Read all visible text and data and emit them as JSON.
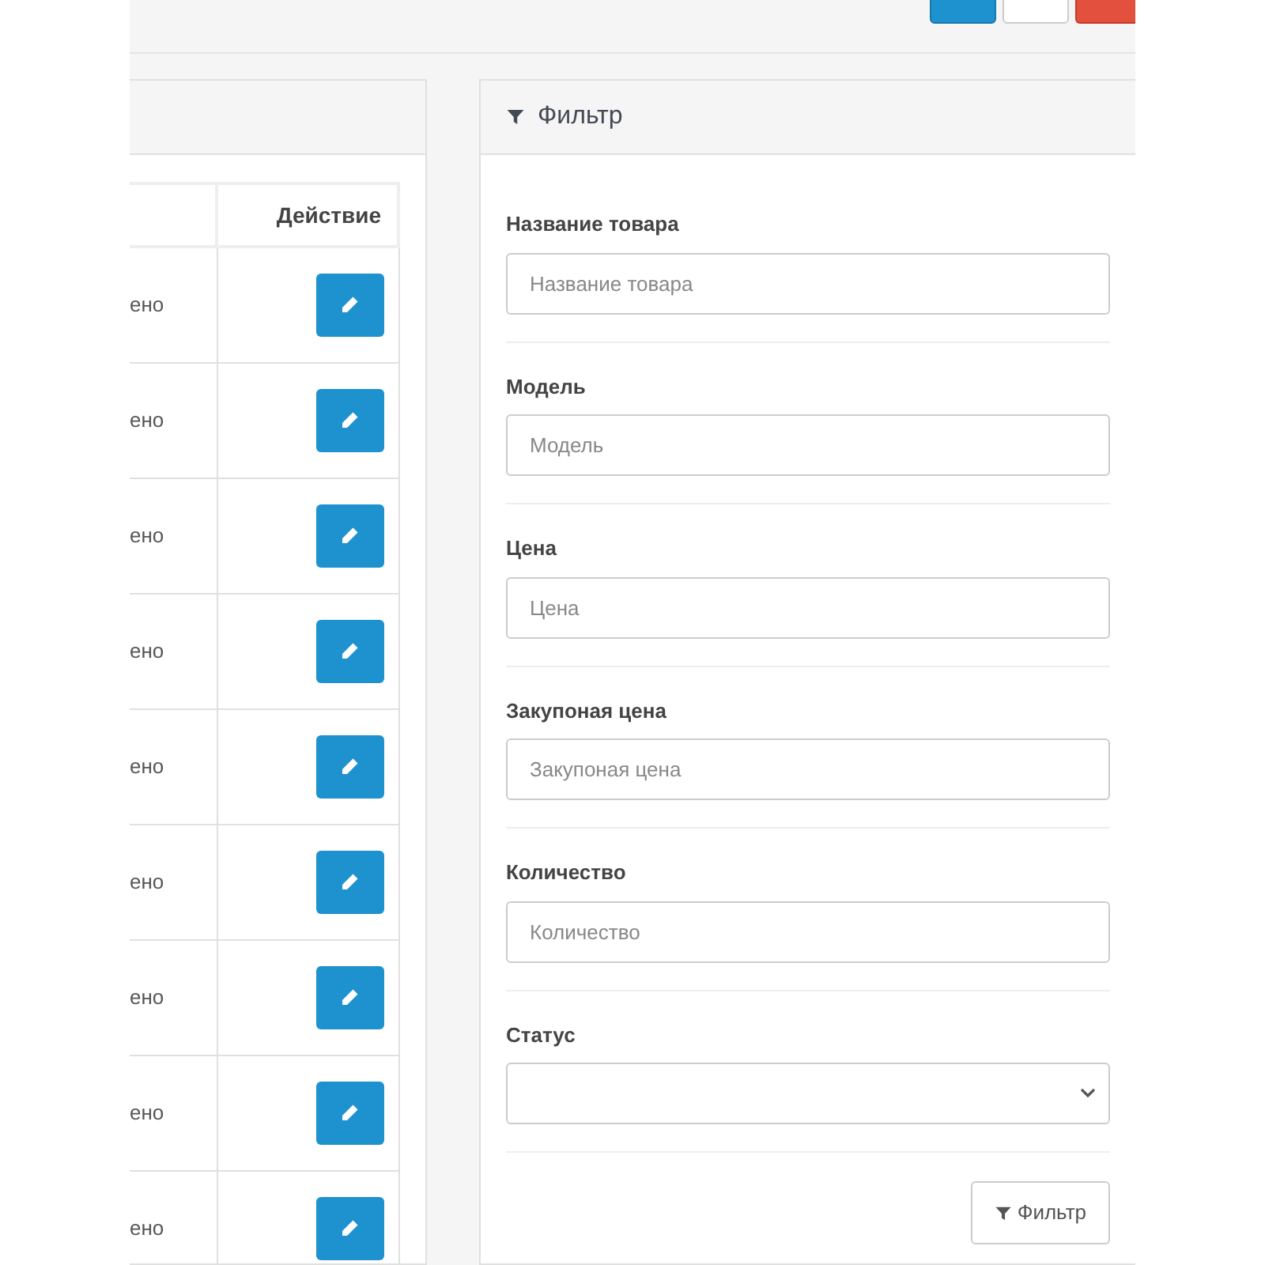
{
  "toolbar": {
    "buttons": [
      {
        "kind": "primary"
      },
      {
        "kind": "default"
      },
      {
        "kind": "danger"
      }
    ]
  },
  "table": {
    "columns": [
      "Действие"
    ],
    "rows": [
      {
        "column_1": "ено"
      },
      {
        "column_1": "ено"
      },
      {
        "column_1": "ено"
      },
      {
        "column_1": "ено"
      },
      {
        "column_1": "ено"
      },
      {
        "column_1": "ено"
      },
      {
        "column_1": "ено"
      },
      {
        "column_1": "ено"
      },
      {
        "column_1": "ено"
      }
    ]
  },
  "filter": {
    "title": "Фильтр",
    "fields": [
      {
        "kind": "input",
        "label": "Название товара",
        "placeholder": "Название товара"
      },
      {
        "kind": "input",
        "label": "Модель",
        "placeholder": "Модель"
      },
      {
        "kind": "input",
        "label": "Цена",
        "placeholder": "Цена"
      },
      {
        "kind": "input",
        "label": "Закупоная цена",
        "placeholder": "Закупоная цена"
      },
      {
        "kind": "input",
        "label": "Количество",
        "placeholder": "Количество"
      },
      {
        "kind": "select",
        "label": "Статус"
      }
    ],
    "button": "Фильтр"
  }
}
